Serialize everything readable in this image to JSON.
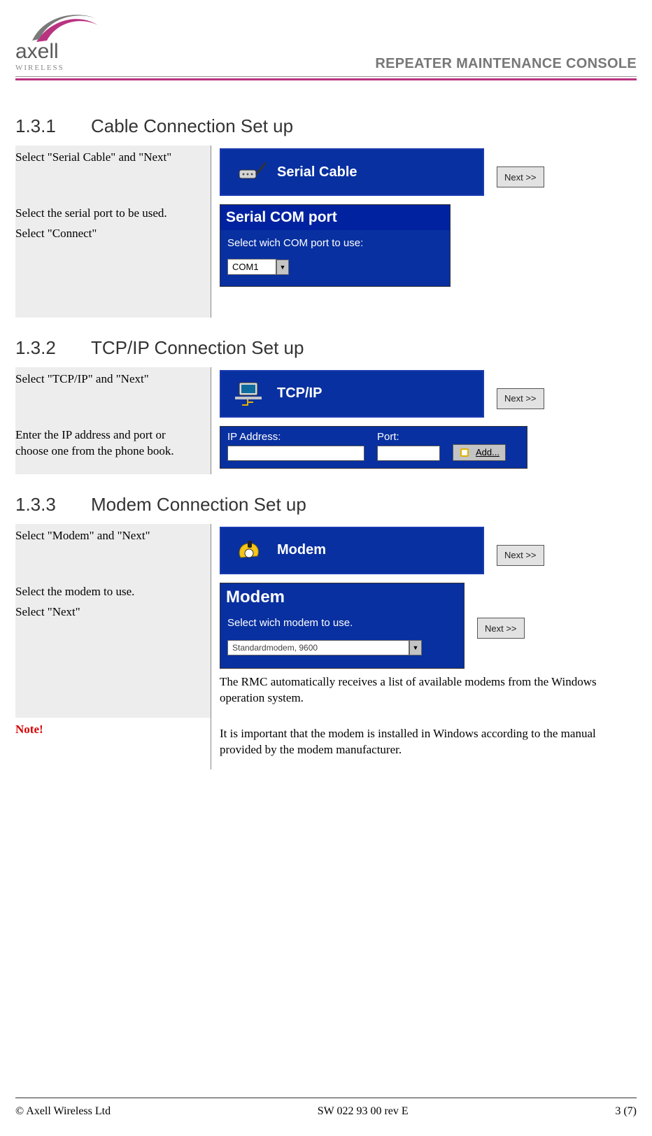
{
  "header": {
    "brand_main": "axell",
    "brand_sub": "WIRELESS",
    "title": "REPEATER MAINTENANCE CONSOLE"
  },
  "sections": {
    "s1": {
      "num": "1.3.1",
      "title": "Cable Connection Set up"
    },
    "s2": {
      "num": "1.3.2",
      "title": "TCP/IP Connection Set up"
    },
    "s3": {
      "num": "1.3.3",
      "title": "Modem Connection Set up"
    }
  },
  "s1": {
    "step1_text": "Select \"Serial Cable\"  and  \"Next\"",
    "banner_label": "Serial Cable",
    "next_label": "Next >>",
    "step2_line1": "Select the serial port to be used.",
    "step2_line2": "Select \"Connect\"",
    "panel_title": "Serial COM port",
    "panel_line": "Select wich COM port to use:",
    "combo_value": "COM1"
  },
  "s2": {
    "step1_text": "Select \"TCP/IP\"  and  \"Next\"",
    "banner_label": "TCP/IP",
    "next_label": "Next >>",
    "step2_text": "Enter the IP address and port or choose one from the phone book.",
    "ip_label": "IP Address:",
    "port_label": "Port:",
    "add_label": "Add..."
  },
  "s3": {
    "step1_text": "Select \"Modem\"  and  \"Next\"",
    "banner_label": "Modem",
    "next_label": "Next >>",
    "step2_line1": "Select the modem to use.",
    "step2_line2": "Select \"Next\"",
    "panel_title": "Modem",
    "panel_line": "Select wich modem to use.",
    "combo_value": "Standardmodem, 9600",
    "next2_label": "Next >>",
    "after_text": "The RMC automatically receives a list of available modems from the Windows operation system.",
    "note_label": "Note!",
    "note_text": "It is important that the modem is installed in Windows according to the manual provided by the modem manufacturer."
  },
  "footer": {
    "left": "© Axell Wireless Ltd",
    "center": "SW 022 93 00 rev E",
    "right": "3 (7)"
  }
}
